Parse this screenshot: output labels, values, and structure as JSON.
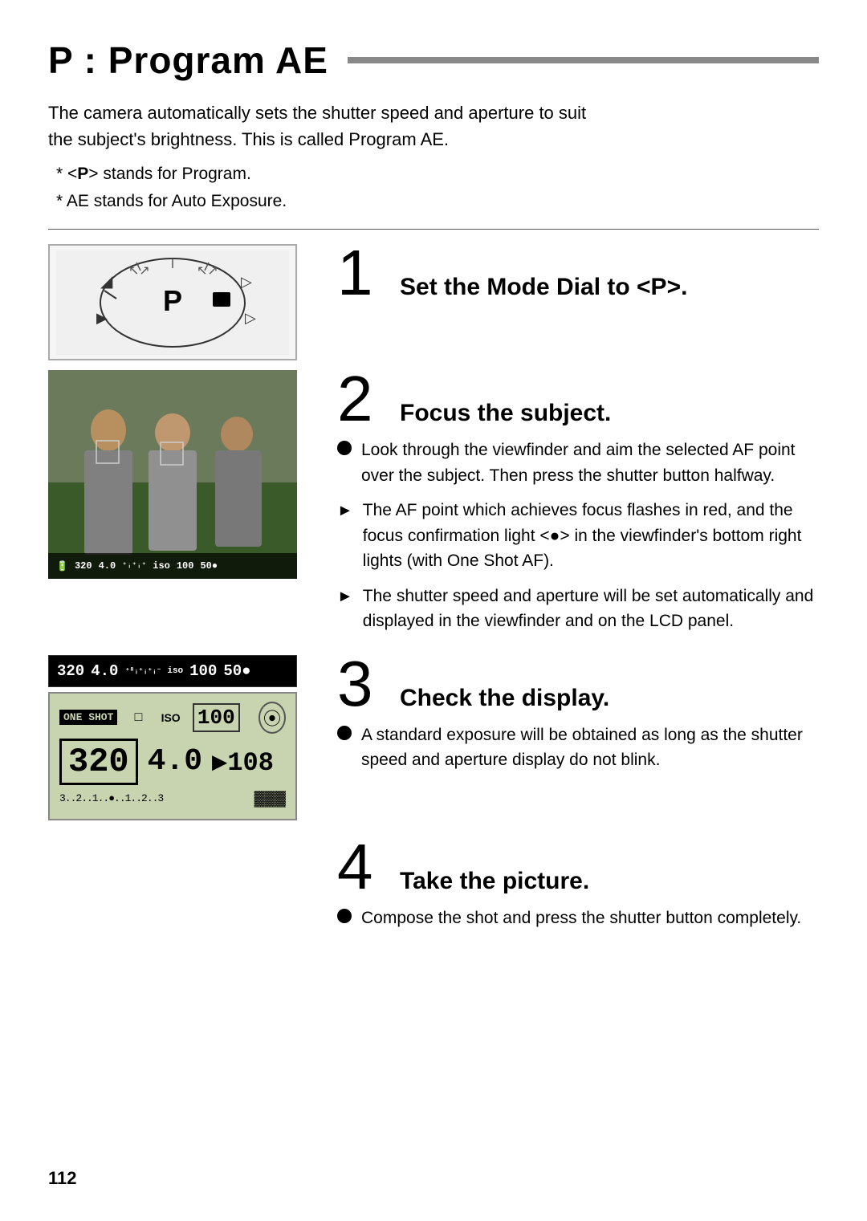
{
  "page": {
    "title": "P : Program AE",
    "page_number": "112",
    "intro": {
      "line1": "The camera automatically sets the shutter speed and aperture to suit",
      "line2": "the subject's brightness. This is called Program AE.",
      "note1": "* <P> stands for Program.",
      "note2": "* AE stands for Auto Exposure."
    },
    "steps": [
      {
        "number": "1",
        "title": "Set the Mode Dial to <P>."
      },
      {
        "number": "2",
        "title": "Focus the subject.",
        "bullets": [
          {
            "type": "circle",
            "text": "Look through the viewfinder and aim the selected AF point over the subject. Then press the shutter button halfway."
          },
          {
            "type": "triangle",
            "text": "The AF point which achieves focus flashes in red, and the focus confirmation light <●> in the viewfinder's bottom right lights (with One Shot AF)."
          },
          {
            "type": "triangle",
            "text": "The shutter speed and aperture will be set automatically and displayed in the viewfinder and on the LCD panel."
          }
        ]
      },
      {
        "number": "3",
        "title": "Check the display.",
        "bullets": [
          {
            "type": "circle",
            "text": "A standard exposure will be obtained as long as the shutter speed and aperture display do not blink."
          }
        ]
      },
      {
        "number": "4",
        "title": "Take the picture.",
        "bullets": [
          {
            "type": "circle",
            "text": "Compose the shot and press the shutter button completely."
          }
        ]
      }
    ],
    "lcd_bar": {
      "shutter": "320",
      "aperture": "4.0",
      "scale_label": "2nInInIuI3",
      "iso_label": "iso",
      "iso_val": "100",
      "shots": "50●"
    },
    "lcd_panel": {
      "one_shot_label": "ONE SHOT",
      "drive_icon": "□",
      "iso_label": "ISO",
      "iso_val": "100",
      "metering_icon": "⦿",
      "shutter": "320",
      "aperture": "4.0",
      "bracket": "▶108",
      "scale": "3..2..1..●..1..2..3",
      "battery_icon": "▓▓▓"
    }
  }
}
